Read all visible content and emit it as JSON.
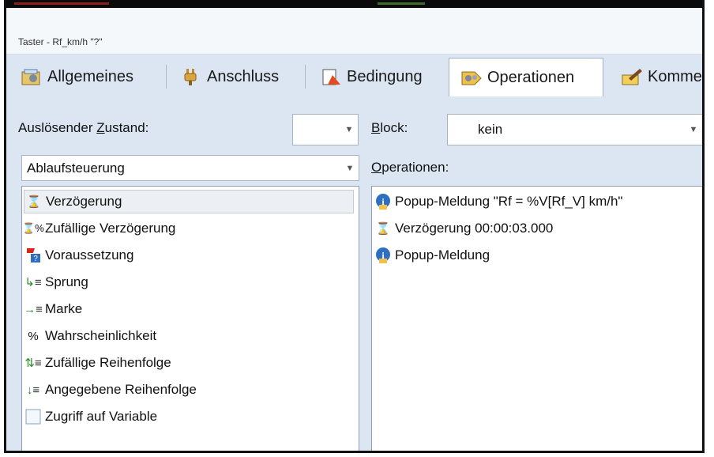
{
  "window": {
    "title": "Taster - Rf_km/h \"?\""
  },
  "tabs": [
    {
      "label": "Allgemeines",
      "icon": "settings-icon"
    },
    {
      "label": "Anschluss",
      "icon": "plug-icon"
    },
    {
      "label": "Bedingung",
      "icon": "document-warning-icon"
    },
    {
      "label": "Operationen",
      "icon": "gears-icon",
      "active": true
    },
    {
      "label": "Kommen",
      "icon": "pencil-note-icon"
    }
  ],
  "trigger": {
    "label_pre": "Auslösender ",
    "label_key": "Z",
    "label_post": "ustand:",
    "value": ""
  },
  "block": {
    "label_key": "B",
    "label_post": "lock:",
    "value": "kein"
  },
  "category": {
    "value": "Ablaufsteuerung"
  },
  "operations_label": {
    "label_key": "O",
    "label_post": "perationen:"
  },
  "available_ops": [
    {
      "label": "Verzögerung",
      "icon": "hourglass-icon",
      "selected": true
    },
    {
      "label": "Zufällige Verzögerung",
      "icon": "hourglass-percent-icon"
    },
    {
      "label": "Voraussetzung",
      "icon": "flag-question-icon"
    },
    {
      "label": "Sprung",
      "icon": "jump-arrow-icon"
    },
    {
      "label": "Marke",
      "icon": "mark-arrow-icon"
    },
    {
      "label": "Wahrscheinlichkeit",
      "icon": "percent-icon"
    },
    {
      "label": "Zufällige Reihenfolge",
      "icon": "shuffle-order-icon"
    },
    {
      "label": "Angegebene Reihenfolge",
      "icon": "fixed-order-icon"
    },
    {
      "label": "Zugriff auf Variable",
      "icon": "variable-box-icon"
    }
  ],
  "operations": [
    {
      "label": "Popup-Meldung \"Rf = %V[Rf_V] km/h\"",
      "icon": "info-icon"
    },
    {
      "label": "Verzögerung 00:00:03.000",
      "icon": "hourglass-icon"
    },
    {
      "label": "Popup-Meldung",
      "icon": "info-icon"
    }
  ],
  "colors": {
    "frame_bg": "#dbe6f2",
    "info_blue": "#2f6fc0",
    "arrow_green": "#2e8b2e"
  }
}
